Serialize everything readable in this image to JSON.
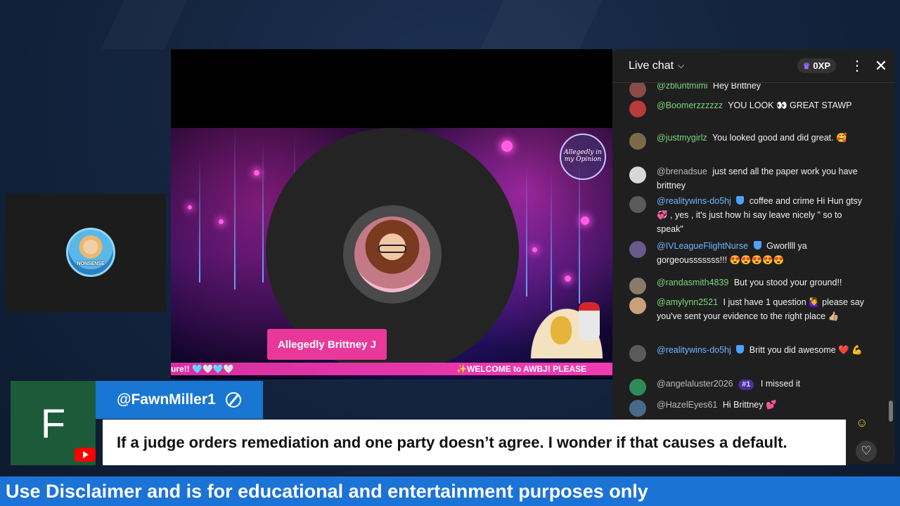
{
  "chat": {
    "title": "Live chat",
    "xp": "0XP",
    "messages": [
      {
        "author": "@zbluntmimi",
        "text": "Hey Brittney"
      },
      {
        "author": "@Boomerzzzzzz",
        "text": "YOU LOOK 👀 GREAT STAWP"
      },
      {
        "author": "@justmygirlz",
        "text": "You looked good and did great. 🥰"
      },
      {
        "author": "@brenadsue",
        "text": "just send all the paper work you have brittney"
      },
      {
        "author": "@realitywins-do5hj",
        "text": "coffee and crime Hi Hun gtsy 💞 , yes , it's just how hi say leave nicely \" so to speak\""
      },
      {
        "author": "@IVLeagueFlightNurse",
        "text": "Gworllll ya gorgeousssssss!!! 😍😍😍😍😍"
      },
      {
        "author": "@randasmith4839",
        "text": "But you stood your ground!!"
      },
      {
        "author": "@amylynn2521",
        "text": "I just have 1 question 🙋‍♀️ please say you've sent your evidence to the right place 👍🏼"
      },
      {
        "author": "@realitywins-do5hj",
        "text": "Britt you did awesome ❤️ 💪"
      },
      {
        "author": "@angelaluster2026",
        "badge": "#1",
        "text": "I missed it"
      },
      {
        "author": "@HazelEyes61",
        "text": "Hi Brittney 💕"
      }
    ]
  },
  "video": {
    "host_name": "Allegedly Brittney J",
    "ticker_left": "ure!! 🩵🤍🩵🤍",
    "ticker_right": "✨WELCOME to AWBJ! PLEASE",
    "logo_text": "Allegedly in my Opinion",
    "cam_badge": "NONSENSE"
  },
  "comment": {
    "avatar_letter": "F",
    "author": "@FawnMiller1",
    "text": "If a judge orders remediation and one party doesn’t agree. I wonder if that causes a default."
  },
  "disclaimer": "Use Disclaimer and is for educational and entertainment purposes only",
  "colors": {
    "accent_blue": "#1c73d6",
    "ticker_pink": "#e8399a",
    "chat_author_green": "#7cd67c",
    "avatar_green": "#1d5a3a",
    "youtube_red": "#ff0000"
  },
  "icons": [
    "chevron-down-icon",
    "crown-icon",
    "more-vert-icon",
    "close-icon",
    "shield-icon",
    "emoji-icon",
    "heart-icon",
    "youtube-icon",
    "ban-icon"
  ]
}
